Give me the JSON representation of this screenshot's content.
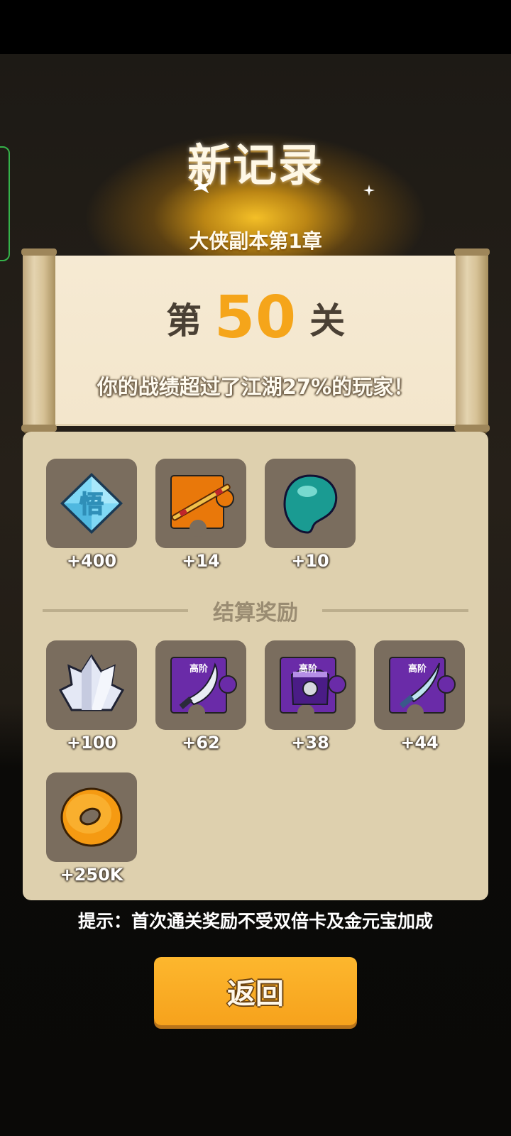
{
  "header": {
    "title": "新记录",
    "chapter": "大侠副本第1章"
  },
  "level": {
    "prefix": "第",
    "number": "50",
    "suffix": "关",
    "beat_text": "你的战绩超过了江湖27%的玩家！"
  },
  "rewards_top": [
    {
      "icon": "wu-diamond-icon",
      "glyph": "悟",
      "amount": "+400"
    },
    {
      "icon": "staff-fragment-icon",
      "amount": "+14"
    },
    {
      "icon": "jade-magatama-icon",
      "amount": "+10"
    }
  ],
  "section_title": "结算奖励",
  "rewards_settle": [
    {
      "icon": "crystal-icon",
      "amount": "+100"
    },
    {
      "icon": "saber-fragment-icon",
      "tag": "高阶",
      "amount": "+62"
    },
    {
      "icon": "armor-fragment-icon",
      "tag": "高阶",
      "amount": "+38"
    },
    {
      "icon": "blade-fragment-icon",
      "tag": "高阶",
      "amount": "+44"
    },
    {
      "icon": "gold-coin-icon",
      "amount": "+250K"
    }
  ],
  "hint": "提示：首次通关奖励不受双倍卡及金元宝加成",
  "back_button": "返回",
  "colors": {
    "accent_orange": "#f5a51a",
    "panel": "#ded0ae",
    "slot": "#7a6d5e",
    "fragment_purple": "#6a2ba8",
    "fragment_orange": "#e9780a"
  }
}
